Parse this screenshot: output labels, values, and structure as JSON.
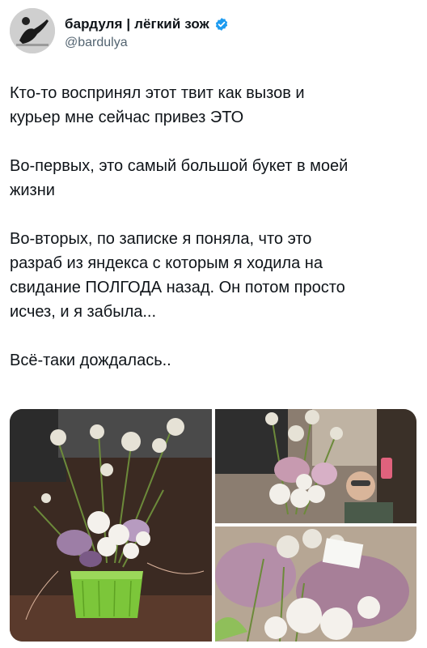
{
  "author": {
    "display_name": "бардуля | лёгкий зож",
    "handle": "@bardulya",
    "verified": true,
    "verified_color": "#1d9bf0"
  },
  "tweet": {
    "paragraphs": [
      "Кто-то воспринял этот твит как вызов и\nкурьер мне сейчас привез ЭТО",
      "Во-первых, это самый большой букет в моей\nжизни",
      "Во-вторых, по записке я поняла, что это\nразраб из яндекса с которым я ходила на\nсвидание ПОЛГОДА назад. Он потом просто\nисчез, и я забыла...",
      "Всё-таки дождалась.."
    ]
  },
  "media": {
    "images": [
      {
        "description_icon": "bouquet-in-green-basket-photo"
      },
      {
        "description_icon": "bouquet-mirror-selfie-photo"
      },
      {
        "description_icon": "bouquet-closeup-with-note-photo"
      }
    ]
  }
}
